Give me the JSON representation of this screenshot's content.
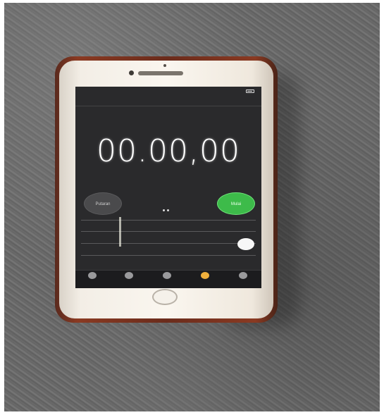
{
  "photo": {
    "surface": "granite-countertop",
    "device": "smartphone",
    "case_color": "#7a3420",
    "phone_color": "#f3eee6"
  },
  "statusbar": {
    "carrier": "",
    "time": "",
    "battery_icon": "battery-icon"
  },
  "app": {
    "title": "",
    "time_display": "00.00,00",
    "accent_green": "#3dbb4a",
    "accent_orange": "#f0b03c"
  },
  "buttons": {
    "lap_label": "Putaran",
    "start_label": "Mulai"
  },
  "tabs": [
    {
      "label": "",
      "icon": "world-clock-icon",
      "active": false
    },
    {
      "label": "",
      "icon": "alarm-icon",
      "active": false
    },
    {
      "label": "",
      "icon": "bed-icon",
      "active": false
    },
    {
      "label": "",
      "icon": "stopwatch-icon",
      "active": true
    },
    {
      "label": "",
      "icon": "timer-icon",
      "active": false
    }
  ]
}
